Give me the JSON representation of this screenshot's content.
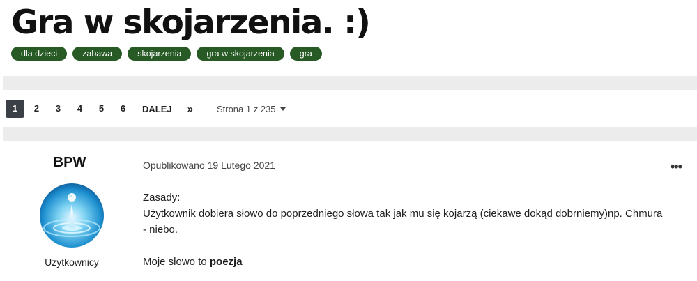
{
  "topic": {
    "title": "Gra w skojarzenia. :)",
    "tags": [
      "dla dzieci",
      "zabawa",
      "skojarzenia",
      "gra w skojarzenia",
      "gra"
    ]
  },
  "pagination": {
    "pages": [
      "1",
      "2",
      "3",
      "4",
      "5",
      "6"
    ],
    "current": "1",
    "next_label": "DALEJ",
    "last_label": "»",
    "page_info": "Strona 1 z 235"
  },
  "post": {
    "author": "BPW",
    "avatar_icon": "water-drop-icon",
    "role": "Użytkownicy",
    "date": "Opublikowano 19 Lutego 2021",
    "menu_label": "•••",
    "line1": "Zasady:",
    "line2": "Użytkownik dobiera słowo do poprzedniego słowa tak jak mu się kojarzą (ciekawe dokąd dobrniemy)np.  Chmura",
    "line3": "- niebo.",
    "word_prefix": "Moje słowo to ",
    "word": "poezja"
  },
  "colors": {
    "tag_bg": "#285a25",
    "active_page_bg": "#3b3f46",
    "band": "#ececec"
  }
}
